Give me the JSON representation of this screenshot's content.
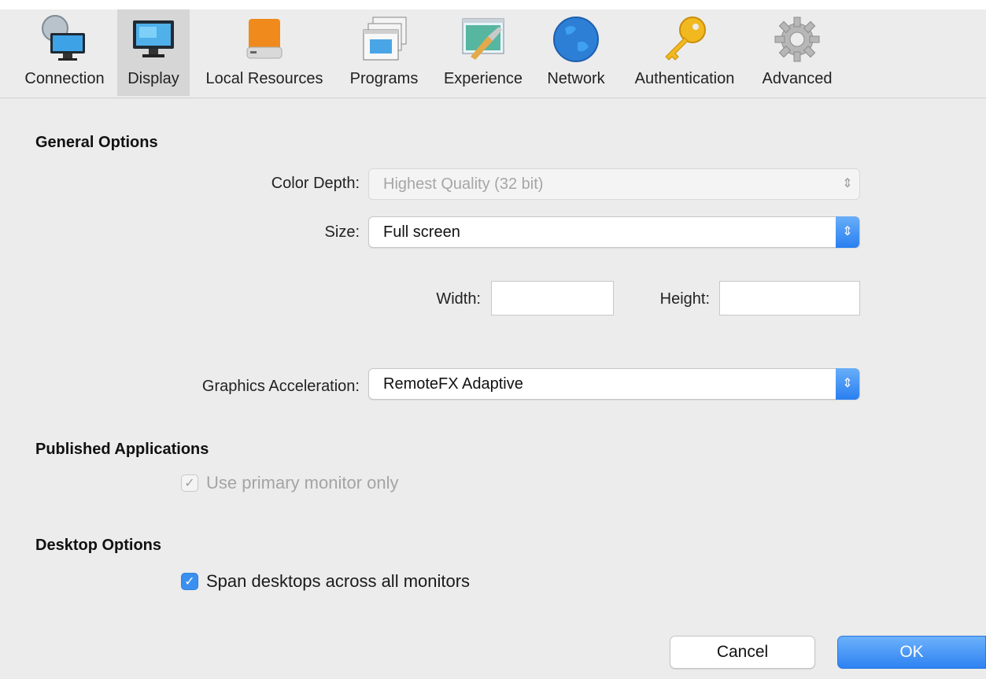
{
  "toolbar": {
    "tabs": [
      {
        "label": "Connection",
        "icon": "monitor-globe-icon",
        "selected": false
      },
      {
        "label": "Display",
        "icon": "display-icon",
        "selected": true
      },
      {
        "label": "Local Resources",
        "icon": "drive-icon",
        "selected": false
      },
      {
        "label": "Programs",
        "icon": "window-stack-icon",
        "selected": false
      },
      {
        "label": "Experience",
        "icon": "paintbrush-window-icon",
        "selected": false
      },
      {
        "label": "Network",
        "icon": "globe-icon",
        "selected": false
      },
      {
        "label": "Authentication",
        "icon": "key-icon",
        "selected": false
      },
      {
        "label": "Advanced",
        "icon": "gear-icon",
        "selected": false
      }
    ]
  },
  "general": {
    "title": "General Options",
    "color_depth_label": "Color Depth:",
    "color_depth_value": "Highest Quality (32 bit)",
    "size_label": "Size:",
    "size_value": "Full screen",
    "width_label": "Width:",
    "width_value": "",
    "height_label": "Height:",
    "height_value": "",
    "graphics_label": "Graphics Acceleration:",
    "graphics_value": "RemoteFX Adaptive"
  },
  "published": {
    "title": "Published Applications",
    "primary_monitor_label": "Use primary monitor only",
    "primary_monitor_checked": true
  },
  "desktop": {
    "title": "Desktop Options",
    "span_label": "Span desktops across all monitors",
    "span_checked": true
  },
  "buttons": {
    "cancel": "Cancel",
    "ok": "OK"
  },
  "colors": {
    "accent": "#2e82f2",
    "toolbar_selected": "#d6d6d6",
    "background": "#ececec"
  }
}
